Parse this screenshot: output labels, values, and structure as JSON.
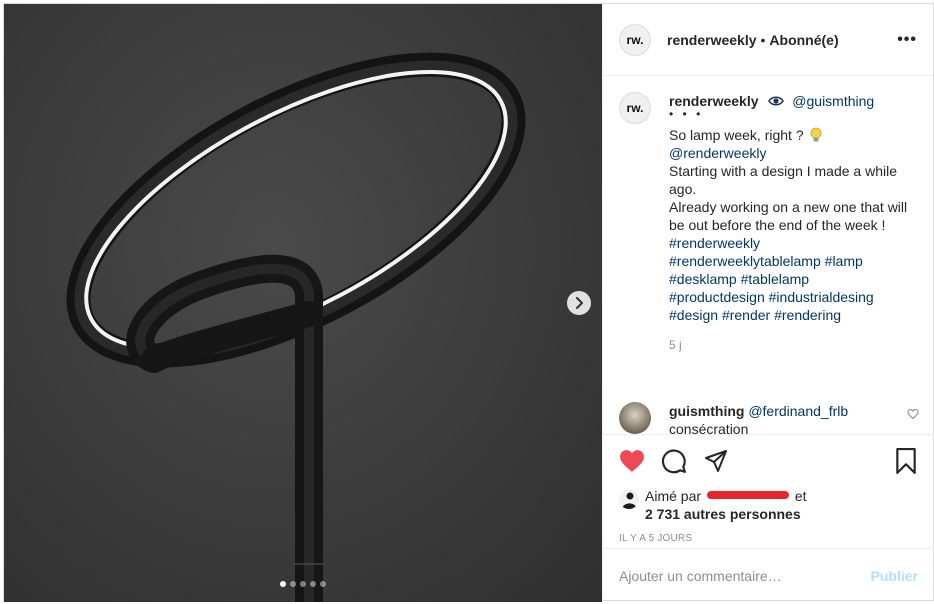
{
  "header": {
    "avatar_initials": "rw.",
    "username": "renderweekly",
    "separator": "•",
    "follow_status": "Abonné(e)",
    "more_label": "•••"
  },
  "caption": {
    "avatar_initials": "rw.",
    "username": "renderweekly",
    "mention": "@guismthing",
    "dots": "• • •",
    "line1": "So lamp week, right ?",
    "mention2": "@renderweekly",
    "line2": "Starting with a design I made a while ago.",
    "line3": "Already working on a new one that will be out before the end of the week !",
    "hashtags": [
      "#renderweekly",
      "#renderweeklytablelamp",
      "#lamp",
      "#desklamp",
      "#tablelamp",
      "#productdesign",
      "#industrialdesing",
      "#design",
      "#render",
      "#rendering"
    ],
    "time": "5 j"
  },
  "comment": {
    "username": "guismthing",
    "mention": "@ferdinand_frlb",
    "text": "consécration"
  },
  "likes": {
    "prefix": "Aimé par",
    "suffix": "et",
    "count_text": "2 731 autres personnes"
  },
  "timestamp": "IL Y A 5 JOURS",
  "add_comment": {
    "placeholder": "Ajouter un commentaire…",
    "publish_label": "Publier"
  },
  "carousel": {
    "slides": 5,
    "active": 1
  },
  "colors": {
    "like_red": "#ed4956",
    "link_blue": "#00376b",
    "publish_disabled": "#b2dffc",
    "muted": "#8e8e8e"
  }
}
